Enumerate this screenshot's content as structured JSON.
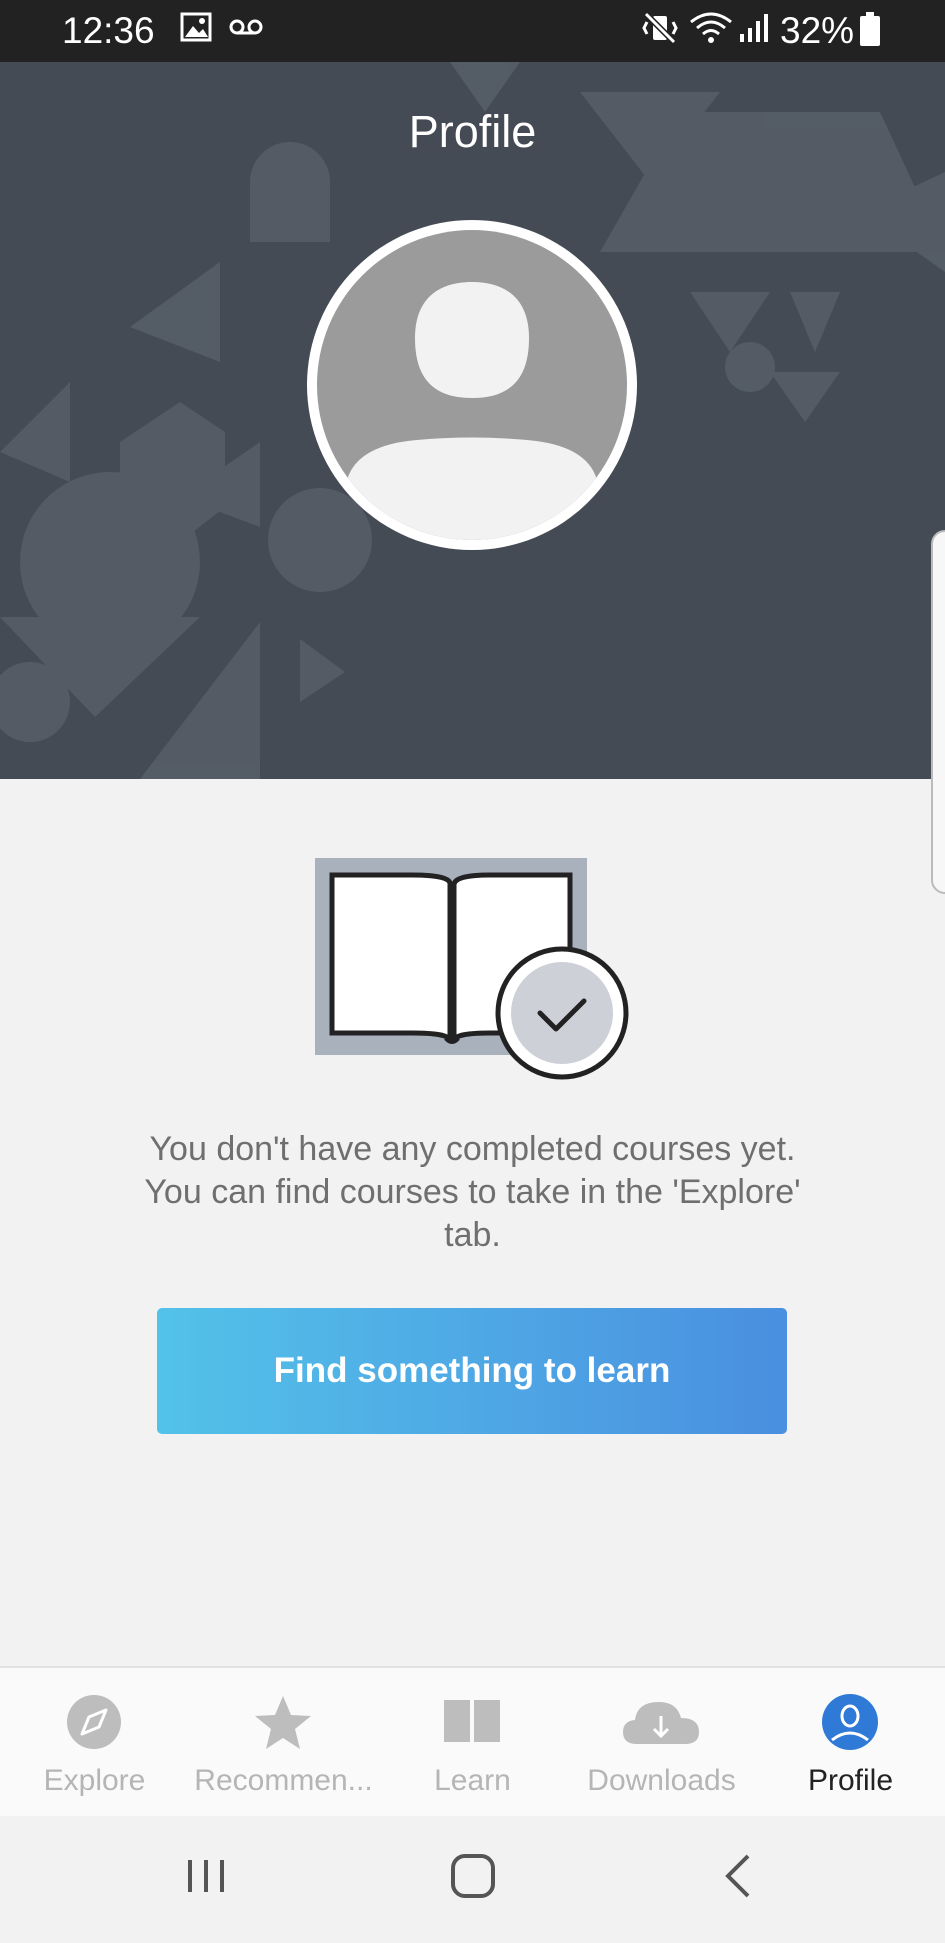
{
  "status_bar": {
    "time": "12:36",
    "battery": "32%"
  },
  "header": {
    "title": "Profile"
  },
  "empty_state": {
    "message": "You don't have any completed courses yet. You can find courses to take in the 'Explore' tab.",
    "cta_label": "Find something to learn"
  },
  "bottom_nav": {
    "items": [
      {
        "label": "Explore",
        "icon": "compass-icon"
      },
      {
        "label": "Recommen...",
        "icon": "star-icon"
      },
      {
        "label": "Learn",
        "icon": "book-icon"
      },
      {
        "label": "Downloads",
        "icon": "cloud-download-icon"
      },
      {
        "label": "Profile",
        "icon": "profile-icon",
        "active": true
      }
    ]
  },
  "colors": {
    "header_bg": "#454b55",
    "accent": "#2f7ad6",
    "cta_gradient_start": "#53c2e9",
    "cta_gradient_end": "#4a8fe0"
  }
}
